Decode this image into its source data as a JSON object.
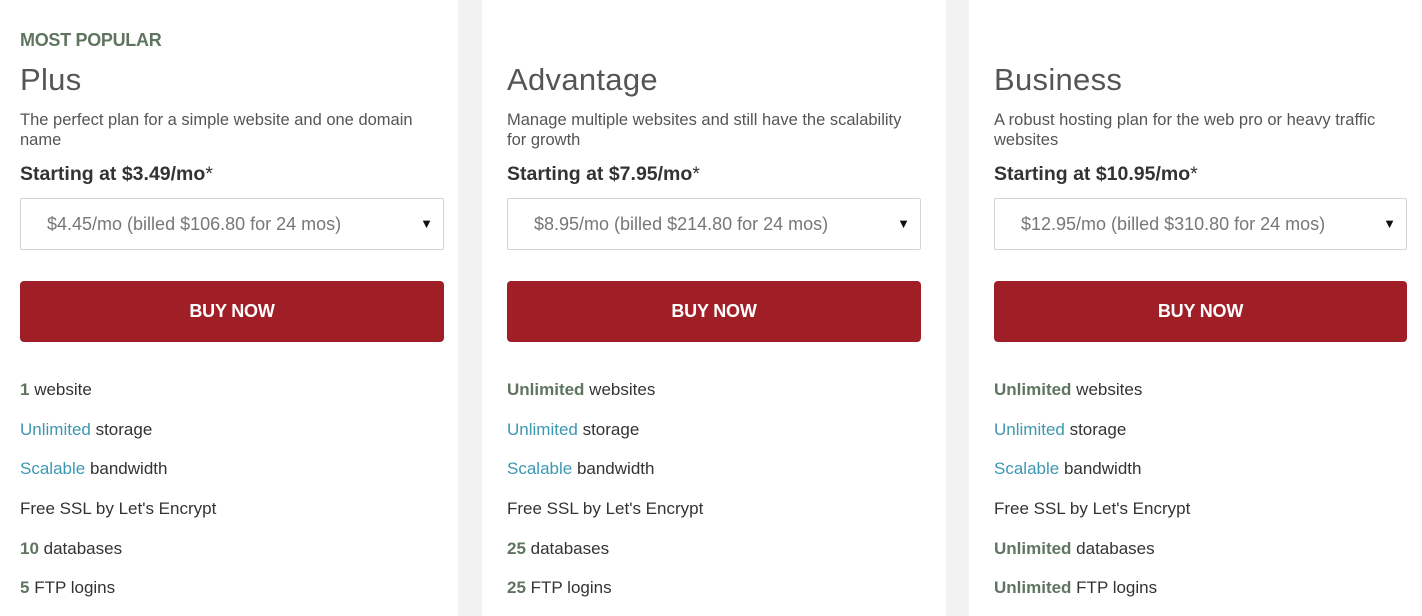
{
  "plans": [
    {
      "badge": "MOST POPULAR",
      "name": "Plus",
      "description": "The perfect plan for a simple website and one domain name",
      "starting": "Starting at $3.49/mo",
      "starting_mark": "*",
      "select_value": "$4.45/mo (billed $106.80 for 24 mos)",
      "buy_label": "BUY NOW",
      "features": [
        {
          "hl": "1",
          "hl_style": "green",
          "text": " website"
        },
        {
          "hl": "Unlimited",
          "hl_style": "blue",
          "text": " storage"
        },
        {
          "hl": "Scalable",
          "hl_style": "blue",
          "text": " bandwidth"
        },
        {
          "hl": "",
          "hl_style": "none",
          "text": "Free SSL by Let's Encrypt"
        },
        {
          "hl": "10",
          "hl_style": "green",
          "text": " databases"
        },
        {
          "hl": "5",
          "hl_style": "green",
          "text": " FTP logins"
        }
      ]
    },
    {
      "badge": "",
      "name": "Advantage",
      "description": "Manage multiple websites and still have the scalability for growth",
      "starting": "Starting at $7.95/mo",
      "starting_mark": "*",
      "select_value": "$8.95/mo (billed $214.80 for 24 mos)",
      "buy_label": "BUY NOW",
      "features": [
        {
          "hl": "Unlimited",
          "hl_style": "green",
          "text": " websites"
        },
        {
          "hl": "Unlimited",
          "hl_style": "blue",
          "text": " storage"
        },
        {
          "hl": "Scalable",
          "hl_style": "blue",
          "text": " bandwidth"
        },
        {
          "hl": "",
          "hl_style": "none",
          "text": "Free SSL by Let's Encrypt"
        },
        {
          "hl": "25",
          "hl_style": "green",
          "text": " databases"
        },
        {
          "hl": "25",
          "hl_style": "green",
          "text": " FTP logins"
        }
      ]
    },
    {
      "badge": "",
      "name": "Business",
      "description": "A robust hosting plan for the web pro or heavy traffic websites",
      "starting": "Starting at $10.95/mo",
      "starting_mark": "*",
      "select_value": "$12.95/mo (billed $310.80 for 24 mos)",
      "buy_label": "BUY NOW",
      "features": [
        {
          "hl": "Unlimited",
          "hl_style": "green",
          "text": " websites"
        },
        {
          "hl": "Unlimited",
          "hl_style": "blue",
          "text": " storage"
        },
        {
          "hl": "Scalable",
          "hl_style": "blue",
          "text": " bandwidth"
        },
        {
          "hl": "",
          "hl_style": "none",
          "text": "Free SSL by Let's Encrypt"
        },
        {
          "hl": "Unlimited",
          "hl_style": "green",
          "text": " databases"
        },
        {
          "hl": "Unlimited",
          "hl_style": "green",
          "text": " FTP logins"
        }
      ]
    }
  ],
  "icons": {
    "dropdown_caret": "▼"
  },
  "colors": {
    "accent_button": "#a01f27",
    "highlight_green": "#5f7560",
    "highlight_blue": "#3c97b2",
    "page_background": "#f2f2f2"
  }
}
